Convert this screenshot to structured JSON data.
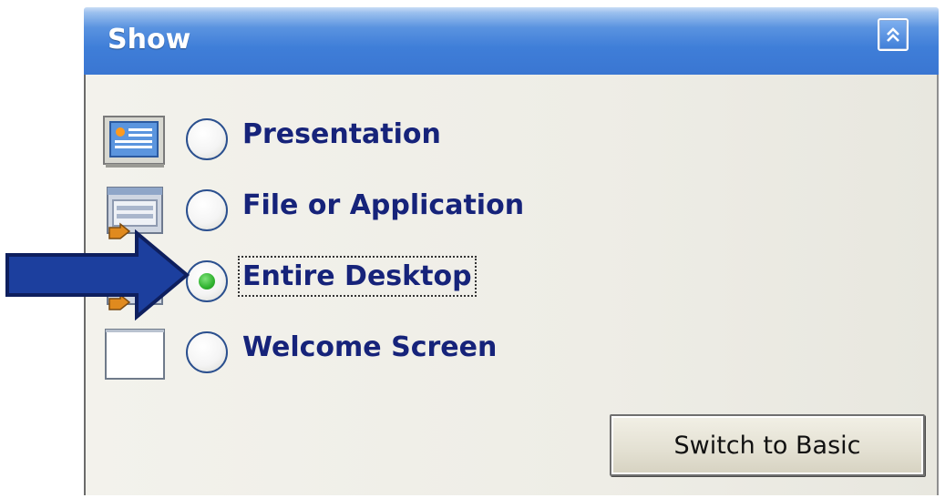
{
  "panel": {
    "title": "Show",
    "collapse_icon": "double-chevron-up-icon"
  },
  "options": [
    {
      "label": "Presentation",
      "icon": "presentation-icon",
      "selected": false
    },
    {
      "label": "File or Application",
      "icon": "file-application-icon",
      "selected": false
    },
    {
      "label": "Entire Desktop",
      "icon": "desktop-share-icon",
      "selected": true
    },
    {
      "label": "Welcome Screen",
      "icon": "blank-screen-icon",
      "selected": false
    }
  ],
  "switch_button": {
    "label": "Switch to Basic"
  },
  "annotation": {
    "icon": "pointer-arrow-icon"
  },
  "colors": {
    "title_bar": "#3f7ed8",
    "label_text": "#16237a",
    "radio_selected": "#2fb22f",
    "arrow": "#1c3f9e"
  }
}
